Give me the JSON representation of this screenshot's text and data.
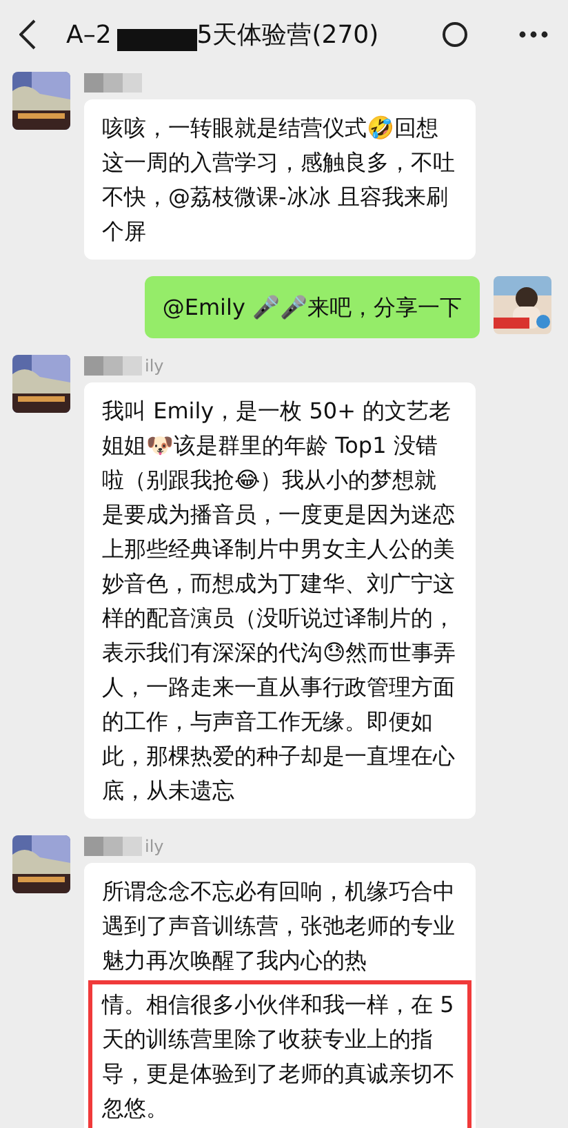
{
  "header": {
    "title_start": "A–2",
    "title_end": "5天体验营(270)",
    "title_redacted": true
  },
  "messages": [
    {
      "kind": "incoming",
      "name_redacted": true,
      "parts": [
        {
          "text": "咳咳，一转眼就是结营仪式🤣回想这一周的入营学习，感触良多，不吐不快，@荔枝微课-冰冰  且容我来刷个屏",
          "highlighted": false
        }
      ]
    },
    {
      "kind": "outgoing",
      "parts": [
        {
          "text": "@Emily 🎤🎤来吧，分享一下",
          "highlighted": false
        }
      ]
    },
    {
      "kind": "incoming",
      "name_redacted": true,
      "name_tail": "ily",
      "parts": [
        {
          "text": "我叫 Emily，是一枚 50+ 的文艺老姐姐🐶该是群里的年龄 Top1 没错啦（别跟我抢😂）我从小的梦想就是要成为播音员，一度更是因为迷恋上那些经典译制片中男女主人公的美妙音色，而想成为丁建华、刘广宁这样的配音演员（没听说过译制片的，表示我们有深深的代沟😓然而世事弄人，一路走来一直从事行政管理方面的工作，与声音工作无缘。即便如此，那棵热爱的种子却是一直埋在心底，从未遗忘",
          "highlighted": false
        }
      ]
    },
    {
      "kind": "incoming",
      "name_redacted": true,
      "name_tail": "ily",
      "parts": [
        {
          "text": "所谓念念不忘必有回响，机缘巧合中遇到了声音训练营，张弛老师的专业魅力再次唤醒了我内心的热",
          "highlighted": false
        },
        {
          "text": "情。相信很多小伙伴和我一样，在 5 天的训练营里除了收获专业上的指导，更是体验到了老师的真诚亲切不忽悠。",
          "highlighted": true
        }
      ]
    }
  ]
}
